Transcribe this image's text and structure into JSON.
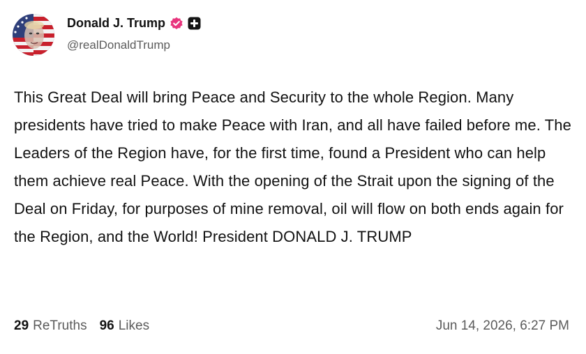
{
  "author": {
    "display_name": "Donald J. Trump",
    "handle": "@realDonaldTrump",
    "verified_badge_icon": "verified-badge-icon",
    "verified_badge_color": "#e8357d",
    "extra_badge_icon": "plus-square-icon"
  },
  "post": {
    "text": "This Great Deal will bring Peace and Security to the whole Region. Many presidents have tried to make Peace with Iran, and all have failed before me. The Leaders of the Region have, for the first time, found a President who can help them achieve real Peace. With the opening of the Strait upon the signing of the Deal on Friday, for purposes of mine removal, oil will flow on both ends again for the Region, and the World! President DONALD J. TRUMP"
  },
  "stats": {
    "retruths_count": "29",
    "retruths_label": "ReTruths",
    "likes_count": "96",
    "likes_label": "Likes"
  },
  "timestamp": "Jun 14, 2026, 6:27 PM"
}
